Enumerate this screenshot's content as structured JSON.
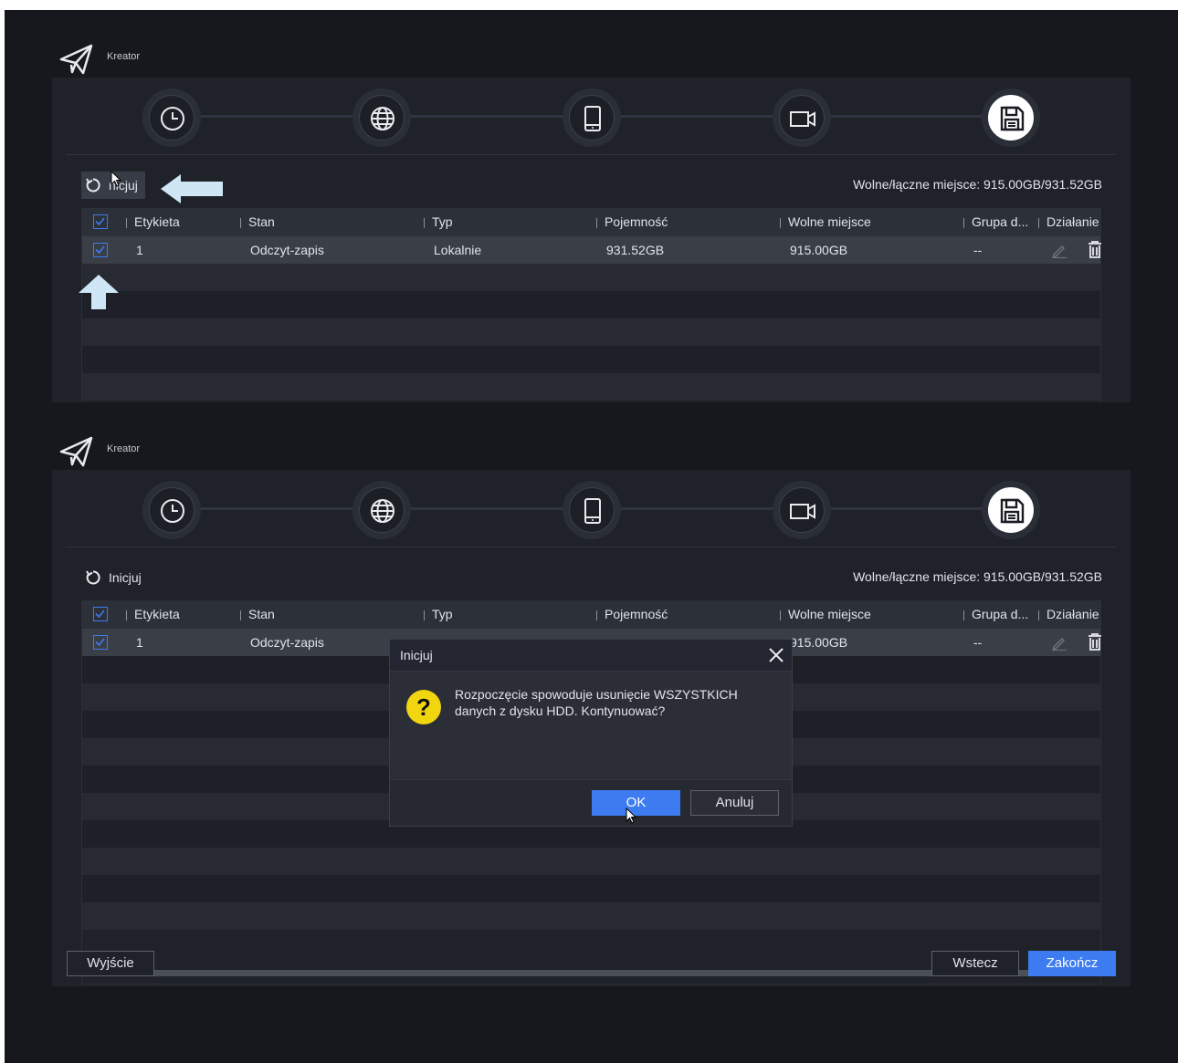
{
  "wizard": {
    "title": "Kreator",
    "steps": [
      {
        "icon": "clock-icon"
      },
      {
        "icon": "globe-icon"
      },
      {
        "icon": "mobile-icon"
      },
      {
        "icon": "camera-icon"
      },
      {
        "icon": "floppy-disk-icon",
        "active": true
      }
    ],
    "init_label": "Inicjuj",
    "init_label_partial": "nicjuj",
    "free_space": "Wolne/łączne miejsce: 915.00GB/931.52GB"
  },
  "table": {
    "columns": [
      "Etykieta",
      "Stan",
      "Typ",
      "Pojemność",
      "Wolne miejsce",
      "Grupa d...",
      "Działanie"
    ],
    "rows": [
      {
        "label": "1",
        "status": "Odczyt-zapis",
        "type": "Lokalnie",
        "capacity": "931.52GB",
        "free": "915.00GB",
        "group": "--"
      }
    ],
    "partial_free": "915.00GB"
  },
  "dialog": {
    "title": "Inicjuj",
    "message": "Rozpoczęcie spowoduje usunięcie WSZYSTKICH danych z dysku HDD. Kontynuować?",
    "ok": "OK",
    "cancel": "Anuluj"
  },
  "footer": {
    "exit": "Wyjście",
    "back": "Wstecz",
    "finish": "Zakończ"
  },
  "colors": {
    "accent": "#3d7bf0",
    "annotation_arrow": "#cfe6f5",
    "question_icon": "#f1d60f"
  }
}
